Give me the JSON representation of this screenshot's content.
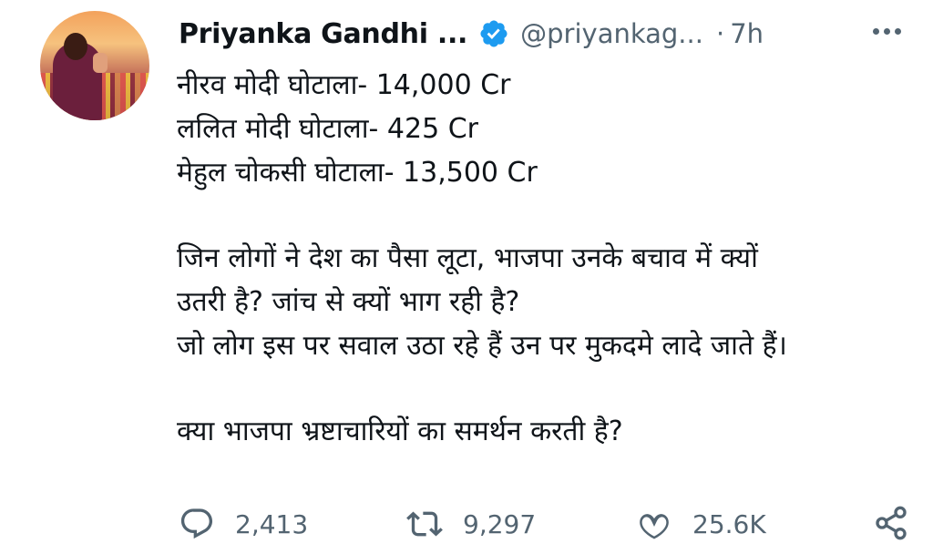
{
  "tweet": {
    "author_name": "Priyanka Gandhi ...",
    "handle": "@priyankag...",
    "separator": "·",
    "time": "7h",
    "lines": [
      "नीरव मोदी घोटाला- 14,000 Cr",
      "ललित मोदी घोटाला- 425 Cr",
      "मेहुल चोकसी घोटाला- 13,500 Cr",
      "जिन लोगों ने देश का पैसा लूटा, भाजपा उनके बचाव में क्यों",
      "उतरी है? जांच से क्यों भाग रही है?",
      "जो लोग इस पर सवाल उठा रहे हैं उन पर मुकदमे लादे जाते हैं।",
      "क्या भाजपा भ्रष्टाचारियों का समर्थन करती है?"
    ],
    "replies": "2,413",
    "retweets": "9,297",
    "likes": "25.6K"
  },
  "icons": {
    "verified": "verified-badge-icon",
    "more": "more-options-icon",
    "reply": "reply-icon",
    "retweet": "retweet-icon",
    "like": "like-icon",
    "share": "share-icon"
  },
  "colors": {
    "verified_blue": "#1d9bf0",
    "secondary_text": "#536471",
    "primary_text": "#0f1419"
  }
}
